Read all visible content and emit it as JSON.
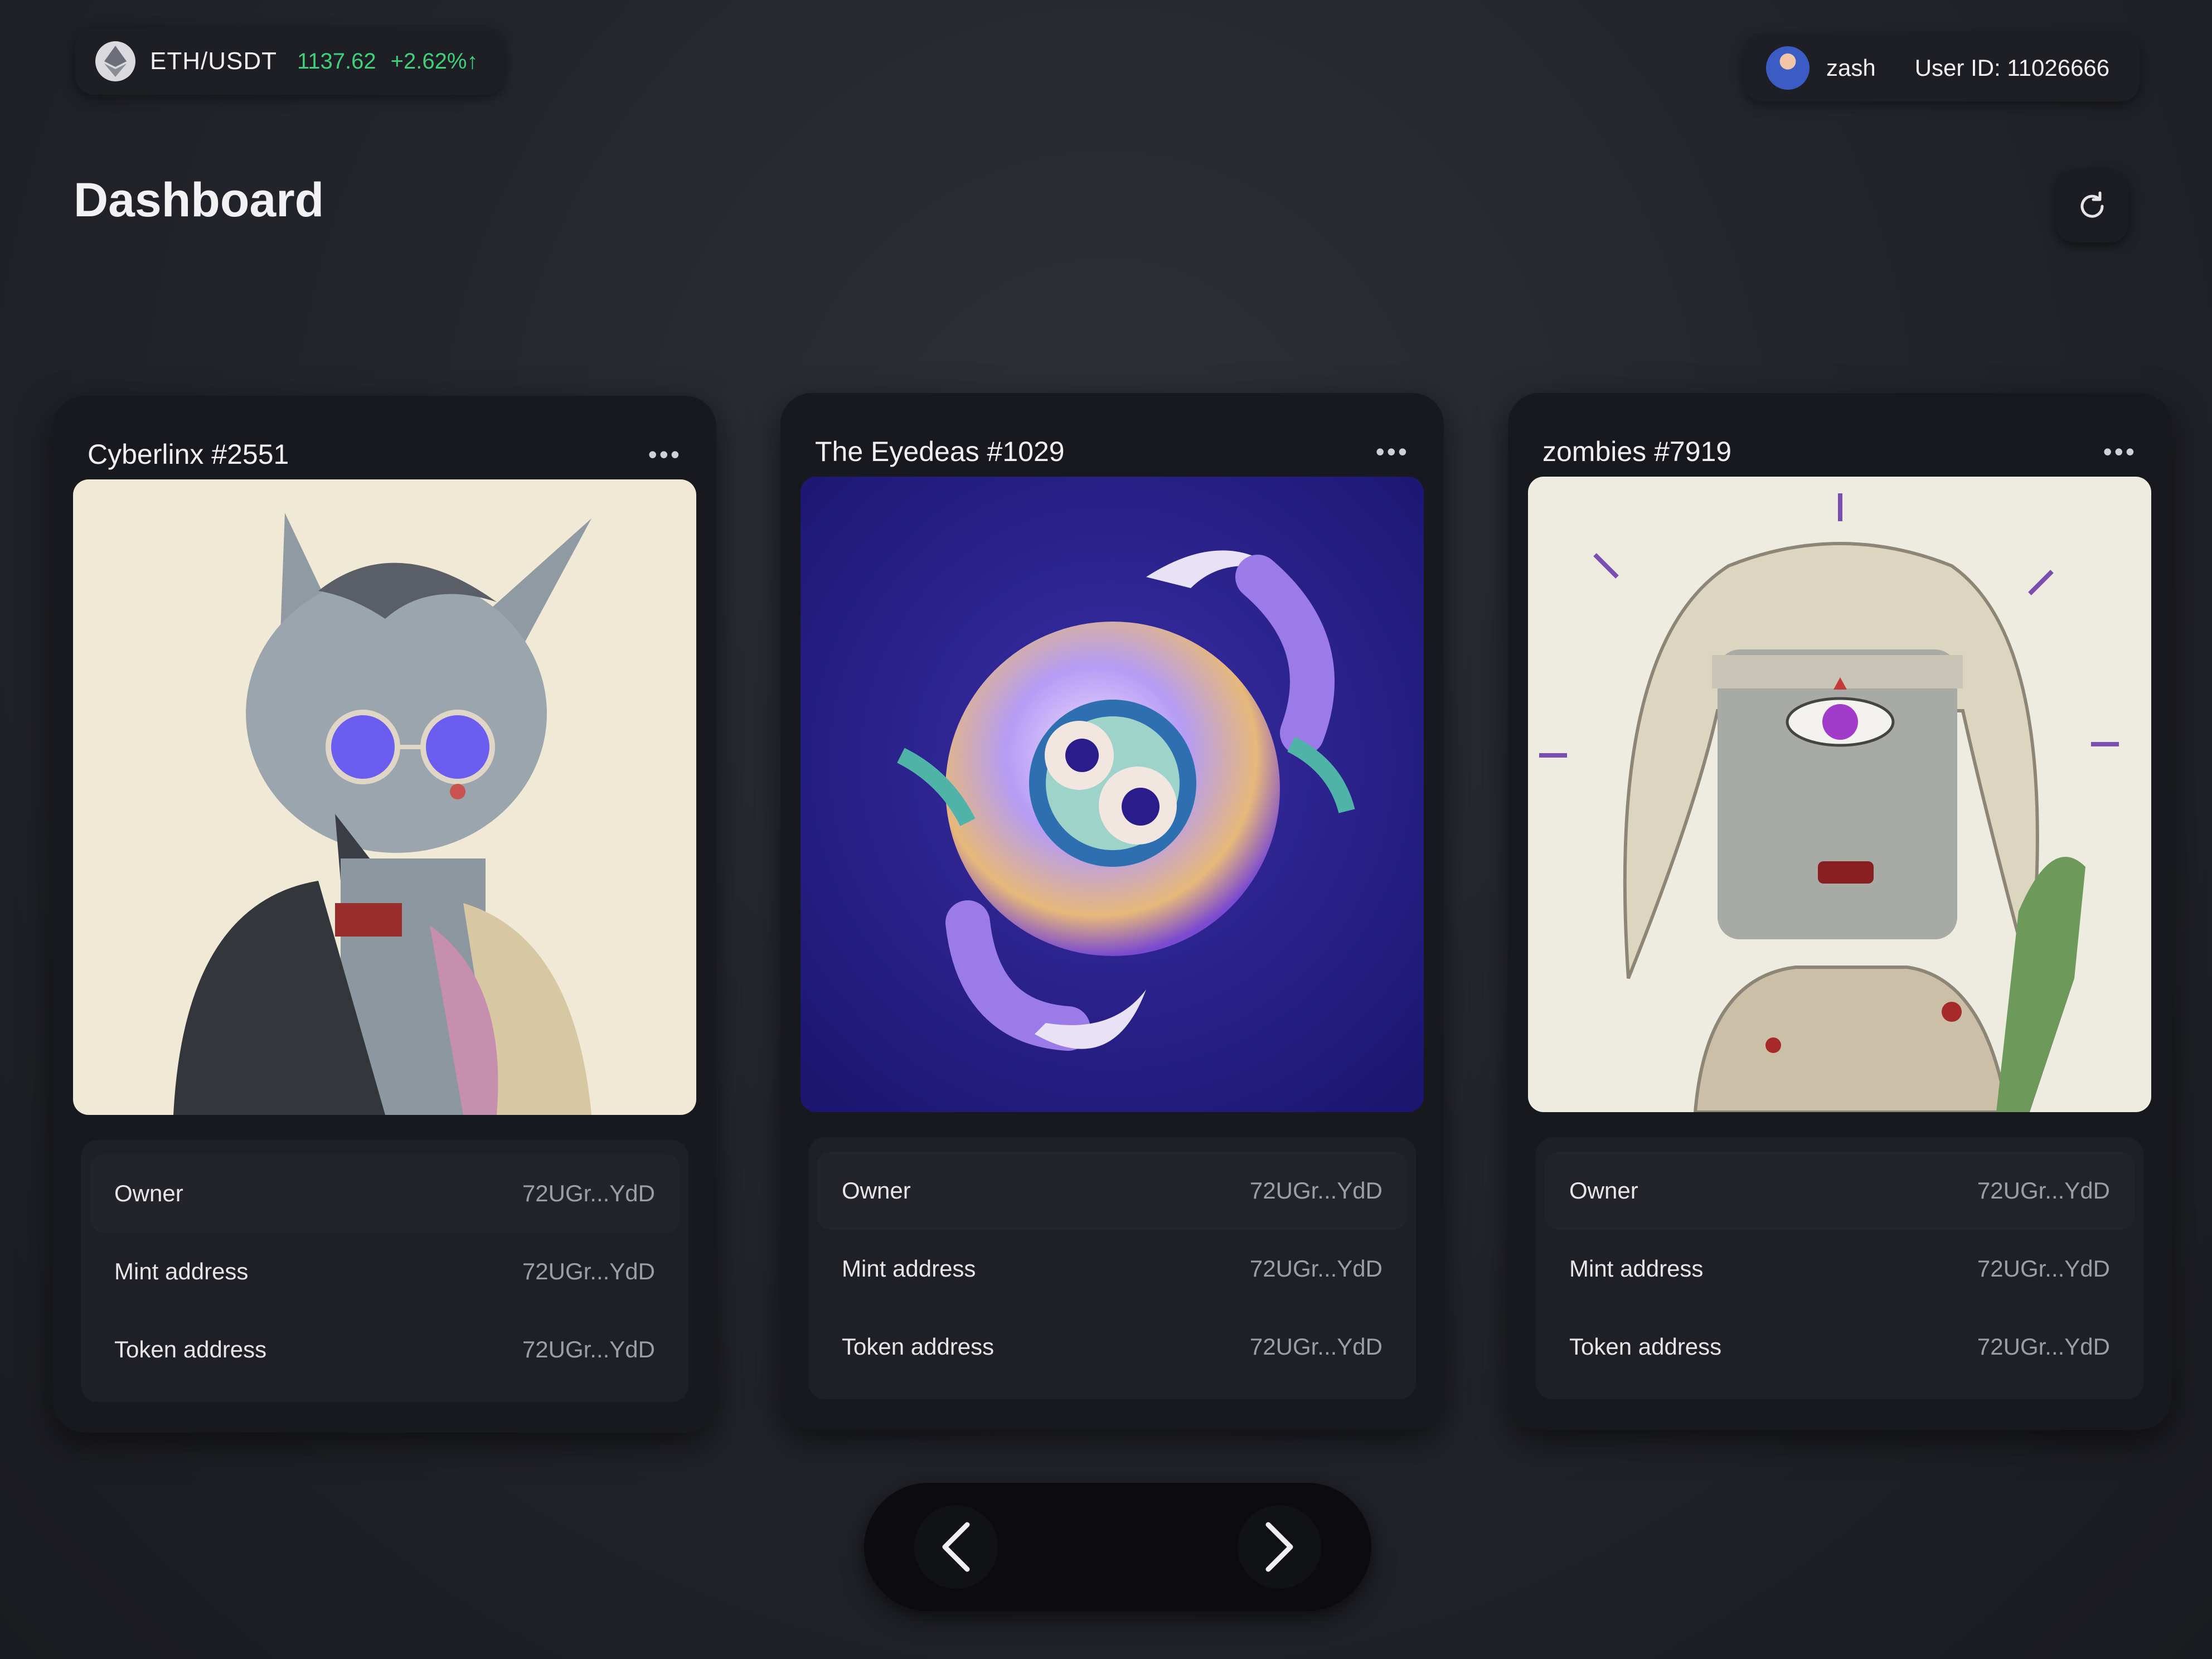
{
  "ticker": {
    "pair": "ETH/USDT",
    "price": "1137.62",
    "change": "+2.62%↑",
    "icon": "ethereum-icon",
    "price_color": "#3ed07b"
  },
  "user": {
    "avatar_icon": "user-avatar",
    "username": "zash",
    "user_id": "User ID: 11026666"
  },
  "header": {
    "title": "Dashboard",
    "refresh_icon": "refresh-icon"
  },
  "cards": [
    {
      "title": "Cyberlinx #2551",
      "more_icon": "more-horizontal-icon",
      "image": "cyber-lynx-artwork",
      "rows": [
        {
          "label": "Owner",
          "value": "72UGr...YdD"
        },
        {
          "label": "Mint address",
          "value": "72UGr...YdD"
        },
        {
          "label": "Token address",
          "value": "72UGr...YdD"
        }
      ]
    },
    {
      "title": "The Eyedeas #1029",
      "more_icon": "more-horizontal-icon",
      "image": "eyeball-creature-artwork",
      "rows": [
        {
          "label": "Owner",
          "value": "72UGr...YdD"
        },
        {
          "label": "Mint address",
          "value": "72UGr...YdD"
        },
        {
          "label": "Token address",
          "value": "72UGr...YdD"
        }
      ]
    },
    {
      "title": "zombies #7919",
      "more_icon": "more-horizontal-icon",
      "image": "zombie-artwork",
      "rows": [
        {
          "label": "Owner",
          "value": "72UGr...YdD"
        },
        {
          "label": "Mint address",
          "value": "72UGr...YdD"
        },
        {
          "label": "Token address",
          "value": "72UGr...YdD"
        }
      ]
    }
  ],
  "pager": {
    "prev_icon": "chevron-left-icon",
    "next_icon": "chevron-right-icon"
  }
}
